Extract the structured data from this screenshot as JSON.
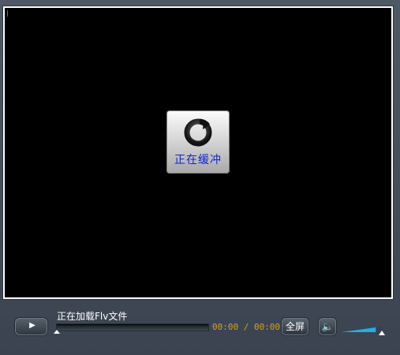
{
  "player": {
    "buffer_label": "正在缓冲"
  },
  "controls": {
    "status_text": "正在加载Flv文件",
    "time_display": "00:00 / 00:00",
    "fullscreen_label": "全屏",
    "play_icon": "play-icon",
    "volume_icon": "speaker-icon"
  },
  "progress": {
    "value": 0
  },
  "volume": {
    "level": 0.85
  },
  "colors": {
    "video_background": "#000000",
    "buffer_text": "#0b26d6",
    "time_text": "#d5a01f",
    "volume_fill": "#1fb1e6"
  }
}
